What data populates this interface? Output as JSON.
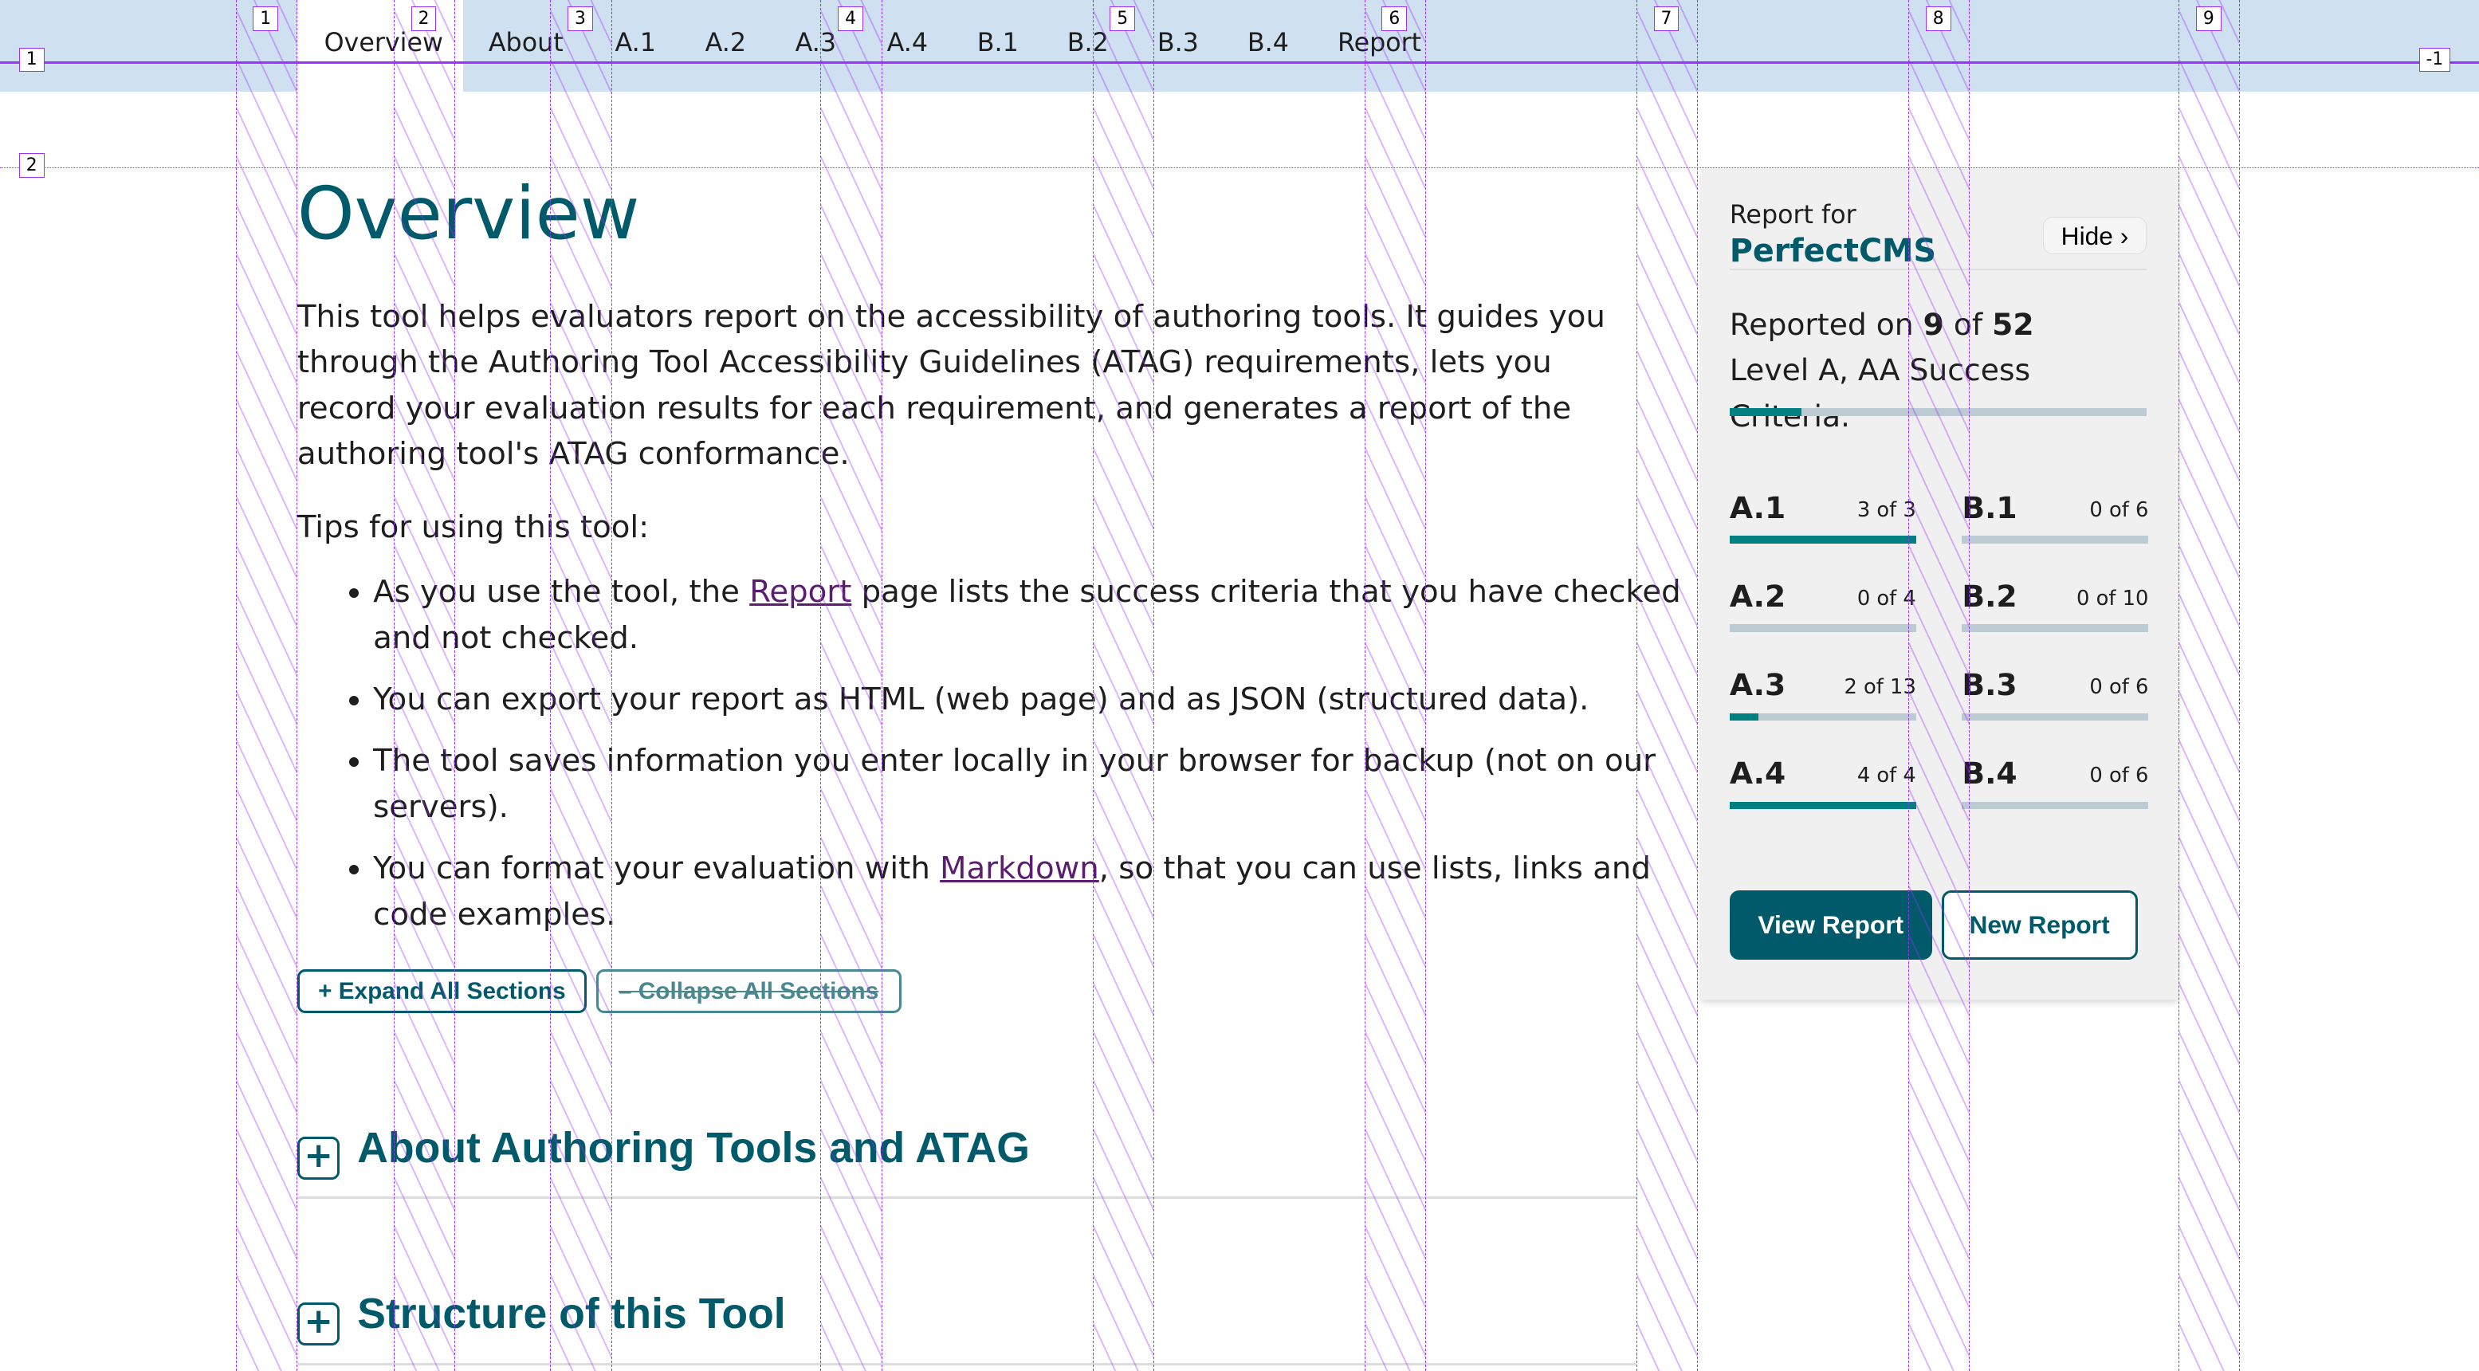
{
  "nav": {
    "tabs": [
      "Overview",
      "About",
      "A.1",
      "A.2",
      "A.3",
      "A.4",
      "B.1",
      "B.2",
      "B.3",
      "B.4",
      "Report"
    ],
    "active": "Overview"
  },
  "main": {
    "title": "Overview",
    "intro": "This tool helps evaluators report on the accessibility of authoring tools. It guides you through the Authoring Tool Accessibility Guidelines (ATAG) requirements, lets you record your evaluation results for each requirement, and generates a report of the authoring tool's ATAG conformance.",
    "tips_heading": "Tips for using this tool:",
    "tips": [
      {
        "pre": "As you use the tool, the ",
        "link": "Report",
        "post": " page lists the success criteria that you have checked and not checked."
      },
      {
        "pre": "You can export your report as HTML (web page) and as JSON (structured data).",
        "link": "",
        "post": ""
      },
      {
        "pre": "The tool saves information you enter locally in your browser for backup (not on our servers).",
        "link": "",
        "post": ""
      },
      {
        "pre": "You can format your evaluation with ",
        "link": "Markdown",
        "post": ", so that you can use lists, links and code examples."
      }
    ],
    "expand_label": "+ Expand All Sections",
    "collapse_label": "– Collapse All Sections",
    "sections": [
      "About Authoring Tools and ATAG",
      "Structure of this Tool"
    ],
    "plus": "+"
  },
  "panel": {
    "report_for": "Report for",
    "product": "PerfectCMS",
    "hide_label": "Hide ›",
    "reported_pre": "Reported on ",
    "done": "9",
    "of": " of ",
    "total": "52",
    "reported_post": "Level A, AA Success Criteria.",
    "progress_fraction": 0.173,
    "criteria": [
      {
        "id": "A.1",
        "count": "3 of 3",
        "fraction": 1
      },
      {
        "id": "B.1",
        "count": "0 of 6",
        "fraction": 0
      },
      {
        "id": "A.2",
        "count": "0 of 4",
        "fraction": 0
      },
      {
        "id": "B.2",
        "count": "0 of 10",
        "fraction": 0
      },
      {
        "id": "A.3",
        "count": "2 of 13",
        "fraction": 0.154
      },
      {
        "id": "B.3",
        "count": "0 of 6",
        "fraction": 0
      },
      {
        "id": "A.4",
        "count": "4 of 4",
        "fraction": 1
      },
      {
        "id": "B.4",
        "count": "0 of 6",
        "fraction": 0
      }
    ],
    "view_label": "View Report",
    "new_label": "New Report"
  },
  "grid_overlay": {
    "column_labels": [
      "1",
      "2",
      "3",
      "4",
      "5",
      "6",
      "7",
      "8",
      "9"
    ],
    "row_labels": [
      "1",
      "2"
    ],
    "end_label": "-1",
    "color": "#9b30ff"
  },
  "colors": {
    "accent": "#005a6a",
    "progress": "#008080",
    "nav_bg": "#cfe0f1",
    "link": "#5b1d6f"
  }
}
